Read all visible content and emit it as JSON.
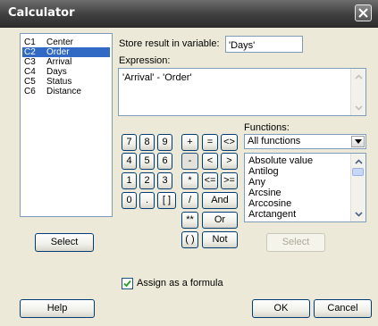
{
  "window": {
    "title": "Calculator"
  },
  "variables": [
    {
      "id": "C1",
      "name": "Center",
      "selected": false
    },
    {
      "id": "C2",
      "name": "Order",
      "selected": true
    },
    {
      "id": "C3",
      "name": "Arrival",
      "selected": false
    },
    {
      "id": "C4",
      "name": "Days",
      "selected": false
    },
    {
      "id": "C5",
      "name": "Status",
      "selected": false
    },
    {
      "id": "C6",
      "name": "Distance",
      "selected": false
    }
  ],
  "store": {
    "label": "Store result in variable:",
    "value": "'Days'"
  },
  "expression": {
    "label": "Expression:",
    "value": "'Arrival' - 'Order'"
  },
  "keypad": {
    "n7": "7",
    "n8": "8",
    "n9": "9",
    "n4": "4",
    "n5": "5",
    "n6": "6",
    "n1": "1",
    "n2": "2",
    "n3": "3",
    "n0": "0",
    "dot": ".",
    "brackets": "[ ]",
    "plus": "+",
    "minus": "-",
    "times": "*",
    "divide": "/",
    "power": "**",
    "parens": "( )",
    "eq": "=",
    "ne": "<>",
    "lt": "<",
    "gt": ">",
    "le": "<=",
    "ge": ">=",
    "and": "And",
    "or": "Or",
    "not": "Not"
  },
  "functions": {
    "label": "Functions:",
    "filter": "All functions",
    "items": [
      "Absolute value",
      "Antilog",
      "Any",
      "Arcsine",
      "Arccosine",
      "Arctangent"
    ]
  },
  "buttons": {
    "select_left": "Select",
    "select_right": "Select",
    "help": "Help",
    "ok": "OK",
    "cancel": "Cancel"
  },
  "assign_formula": {
    "label": "Assign as a formula",
    "checked": true
  }
}
